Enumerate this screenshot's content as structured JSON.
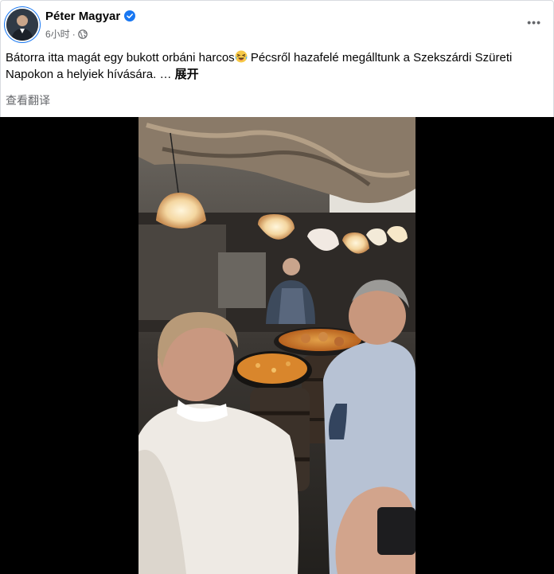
{
  "post": {
    "author": "Péter Magyar",
    "timestamp": "6小时",
    "separator": "·",
    "text_part1": "Bátorra itta magát egy bukott orbáni harcos",
    "text_part2": " Pécsről hazafelé megálltunk a Szekszárdi Szüreti Napokon a helyiek hívására. … ",
    "expand_label": "展开",
    "translate_label": "查看翻译",
    "more_label": "•••"
  },
  "icons": {
    "avatar": "profile-photo",
    "verified": "verified-badge-icon",
    "audience": "globe-icon",
    "emoji": "laughing-emoji-icon",
    "more": "more-options-icon"
  },
  "colors": {
    "verified_blue": "#1877f2",
    "secondary_text": "#65676b",
    "primary_text": "#050505",
    "video_background": "#000000"
  }
}
